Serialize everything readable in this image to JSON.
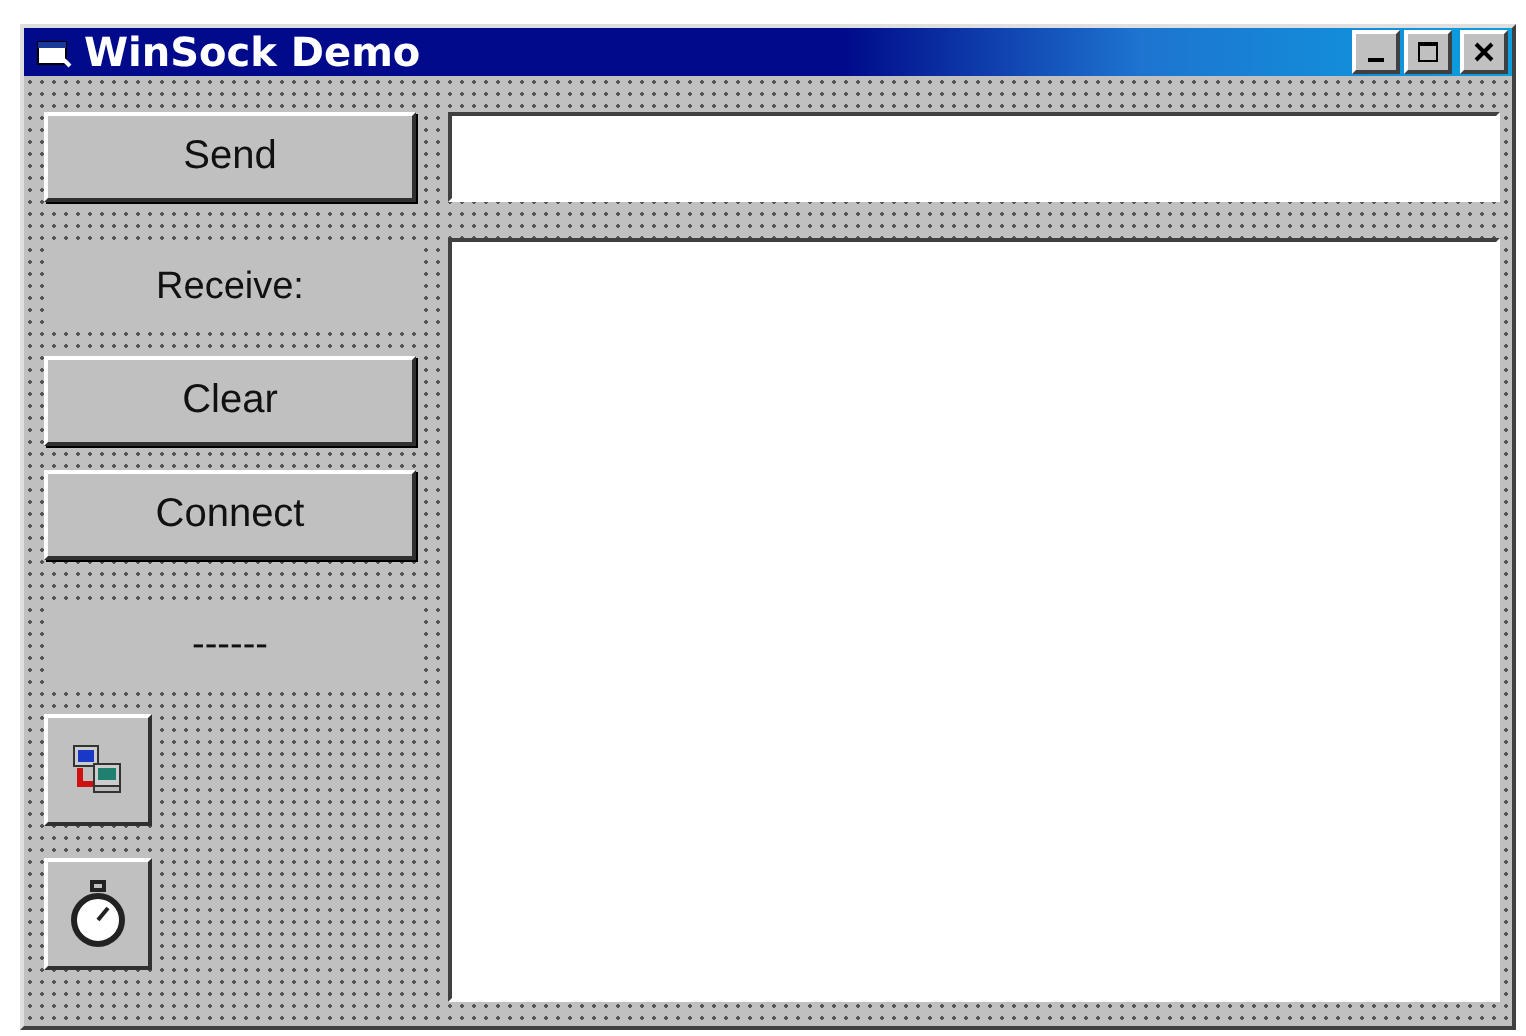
{
  "window": {
    "title": "WinSock Demo"
  },
  "send_button": "Send",
  "receive_label": "Receive:",
  "clear_button": "Clear",
  "connect_button": "Connect",
  "status_label": "------",
  "controls": [
    {
      "kind": "winsock"
    },
    {
      "kind": "timer"
    }
  ]
}
